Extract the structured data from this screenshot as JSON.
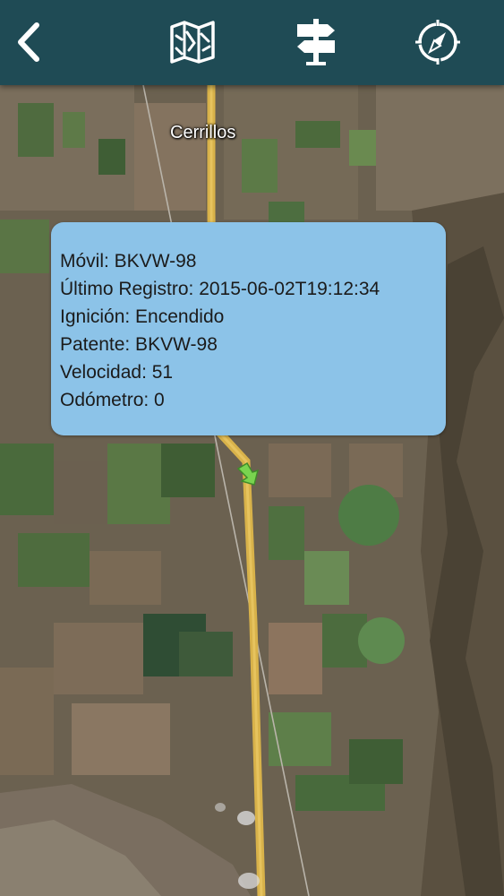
{
  "header": {
    "back_icon": "chevron-left-icon",
    "map_icon": "folded-map-icon",
    "route_icon": "signpost-icon",
    "compass_icon": "compass-icon"
  },
  "map": {
    "place_label": "Cerrillos",
    "marker_icon": "vehicle-arrow-icon",
    "road_color": "#d8b24a",
    "marker_color": "#79d44f"
  },
  "info": {
    "movil": "Móvil: BKVW-98",
    "ultimo_registro": "Último Registro: 2015-06-02T19:12:34",
    "ignicion": "Ignición: Encendido",
    "patente": "Patente: BKVW-98",
    "velocidad": "Velocidad: 51",
    "odometro": "Odómetro: 0"
  },
  "colors": {
    "header_bg": "#1f4b55",
    "info_bg": "#8cc3e8"
  }
}
